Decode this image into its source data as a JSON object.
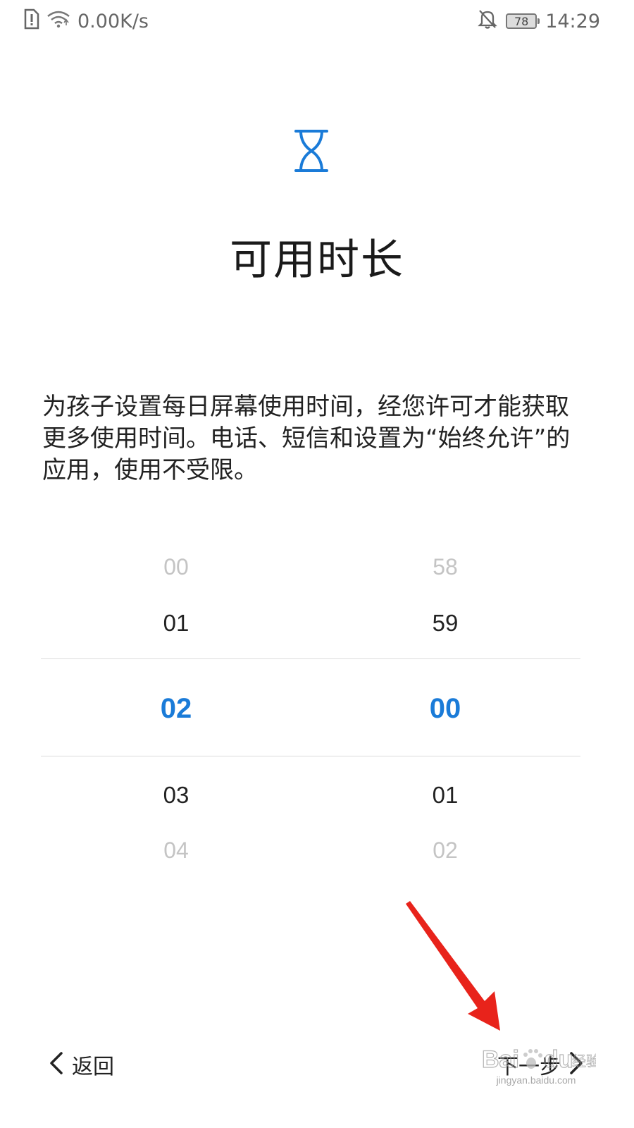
{
  "status_bar": {
    "net_speed": "0.00K/s",
    "battery_level": "78",
    "time": "14:29",
    "icons": [
      "sim-alert-icon",
      "wifi-icon",
      "bell-off-icon",
      "battery-icon"
    ]
  },
  "header": {
    "icon": "hourglass-icon",
    "title": "可用时长"
  },
  "description": "为孩子设置每日屏幕使用时间，经您许可才能获取更多使用时间。电话、短信和设置为“始终允许”的应用，使用不受限。",
  "picker": {
    "hours": {
      "items": [
        "00",
        "01",
        "02",
        "03",
        "04"
      ],
      "selected_index": 2
    },
    "minutes": {
      "items": [
        "58",
        "59",
        "00",
        "01",
        "02"
      ],
      "selected_index": 2
    }
  },
  "navigation": {
    "back_label": "返回",
    "next_label": "下一步"
  },
  "watermark": {
    "url_text": "jingyan.baidu.com"
  },
  "colors": {
    "accent": "#1a7bd8",
    "annotation_arrow": "#e8231b"
  }
}
